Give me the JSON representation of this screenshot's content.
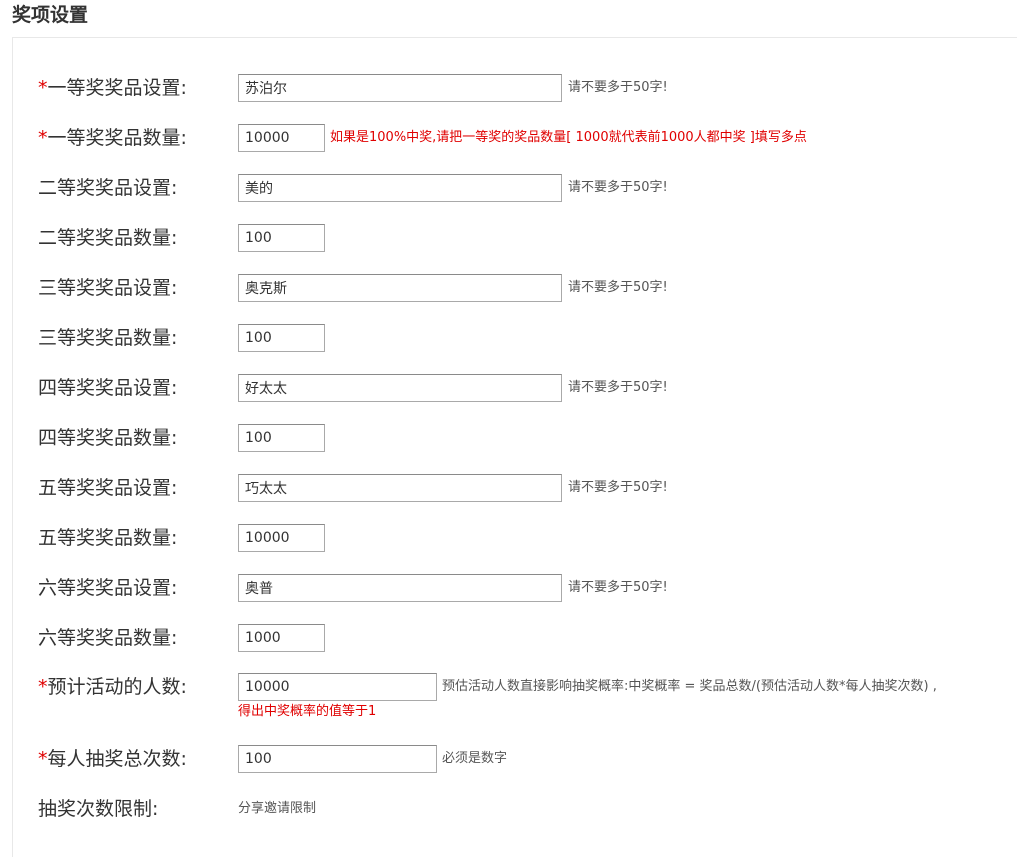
{
  "page": {
    "title": "奖项设置"
  },
  "prizes": [
    {
      "name_label": "一等奖奖品设置:",
      "name_value": "苏泊尔",
      "name_hint": "请不要多于50字!",
      "qty_label": "一等奖奖品数量:",
      "qty_value": "10000",
      "qty_hint": "如果是100%中奖,请把一等奖的奖品数量[ 1000就代表前1000人都中奖 ]填写多点",
      "required": "*"
    },
    {
      "name_label": "二等奖奖品设置:",
      "name_value": "美的",
      "name_hint": "请不要多于50字!",
      "qty_label": "二等奖奖品数量:",
      "qty_value": "100"
    },
    {
      "name_label": "三等奖奖品设置:",
      "name_value": "奥克斯",
      "name_hint": "请不要多于50字!",
      "qty_label": "三等奖奖品数量:",
      "qty_value": "100"
    },
    {
      "name_label": "四等奖奖品设置:",
      "name_value": "好太太",
      "name_hint": "请不要多于50字!",
      "qty_label": "四等奖奖品数量:",
      "qty_value": "100"
    },
    {
      "name_label": "五等奖奖品设置:",
      "name_value": "巧太太",
      "name_hint": "请不要多于50字!",
      "qty_label": "五等奖奖品数量:",
      "qty_value": "10000"
    },
    {
      "name_label": "六等奖奖品设置:",
      "name_value": "奥普",
      "name_hint": "请不要多于50字!",
      "qty_label": "六等奖奖品数量:",
      "qty_value": "1000"
    }
  ],
  "participants": {
    "required": "*",
    "label": "预计活动的人数:",
    "value": "10000",
    "hint": "预估活动人数直接影响抽奖概率:中奖概率 = 奖品总数/(预估活动人数*每人抽奖次数) ,",
    "subhint": "得出中奖概率的值等于1"
  },
  "draws": {
    "required": "*",
    "label": "每人抽奖总次数:",
    "value": "100",
    "hint": "必须是数字"
  },
  "limit": {
    "label": "抽奖次数限制:",
    "value": "分享邀请限制"
  },
  "colors": {
    "required": "#e00000",
    "hint": "#555555",
    "label": "#333333"
  }
}
